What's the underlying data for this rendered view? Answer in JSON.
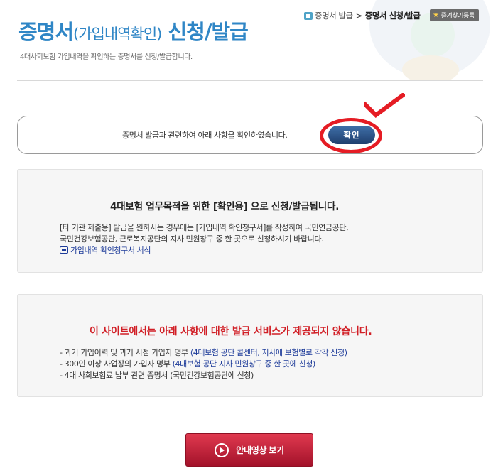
{
  "header": {
    "title_main": "증명서",
    "title_paren": "(가입내역확인)",
    "title_tail": " 신청/발급",
    "subtitle": "4대사회보험 가입내역을 확인하는 증명서를 신청/발급합니다."
  },
  "breadcrumb": {
    "parent": "증명서 발급",
    "separator": ">",
    "current": "증명서 신청/발급"
  },
  "favorite": {
    "label": "즐겨찾기등록",
    "icon": "star-icon"
  },
  "confirm": {
    "text": "증명서 발급과 관련하여 아래 사항을 확인하였습니다.",
    "button_label": "확인"
  },
  "notice_purpose": {
    "heading": "4대보험 업무목적을 위한 [확인용] 으로 신청/발급됩니다.",
    "line1": "[타 기관 제출용] 발급을 원하시는 경우에는 [가입내역 확인청구서]를 작성하여 국민연금공단,",
    "line2": "국민건강보험공단, 근로복지공단의 지사 민원창구 중 한 곳으로 신청하시기 바랍니다.",
    "link": "가입내역 확인청구서 서식"
  },
  "notice_unavailable": {
    "heading": "이 사이트에서는 아래 사항에 대한 발급 서비스가 제공되지 않습니다.",
    "items": [
      {
        "text": "- 과거 가입이력 및 과거 시점 가입자 명부 ",
        "note": "(4대보험 공단 콜센터, 지사에 보험별로 각각 신청)"
      },
      {
        "text": "- 300인 이상 사업장의 가입자 명부 ",
        "note": "(4대보험 공단 지사 민원창구 중 한 곳에 신청)"
      },
      {
        "text": "- 4대 사회보험료 납부 관련 증명서 ",
        "note": "(국민건강보험공단에 신청)"
      }
    ]
  },
  "video_button": {
    "label": "안내영상 보기"
  },
  "colors": {
    "title": "#2f86c6",
    "annotation_red": "#e51c24",
    "notice_red": "#d11f26",
    "link_blue": "#1d3b99",
    "confirm_button": "#2a4f82",
    "video_button": "#c62038"
  }
}
